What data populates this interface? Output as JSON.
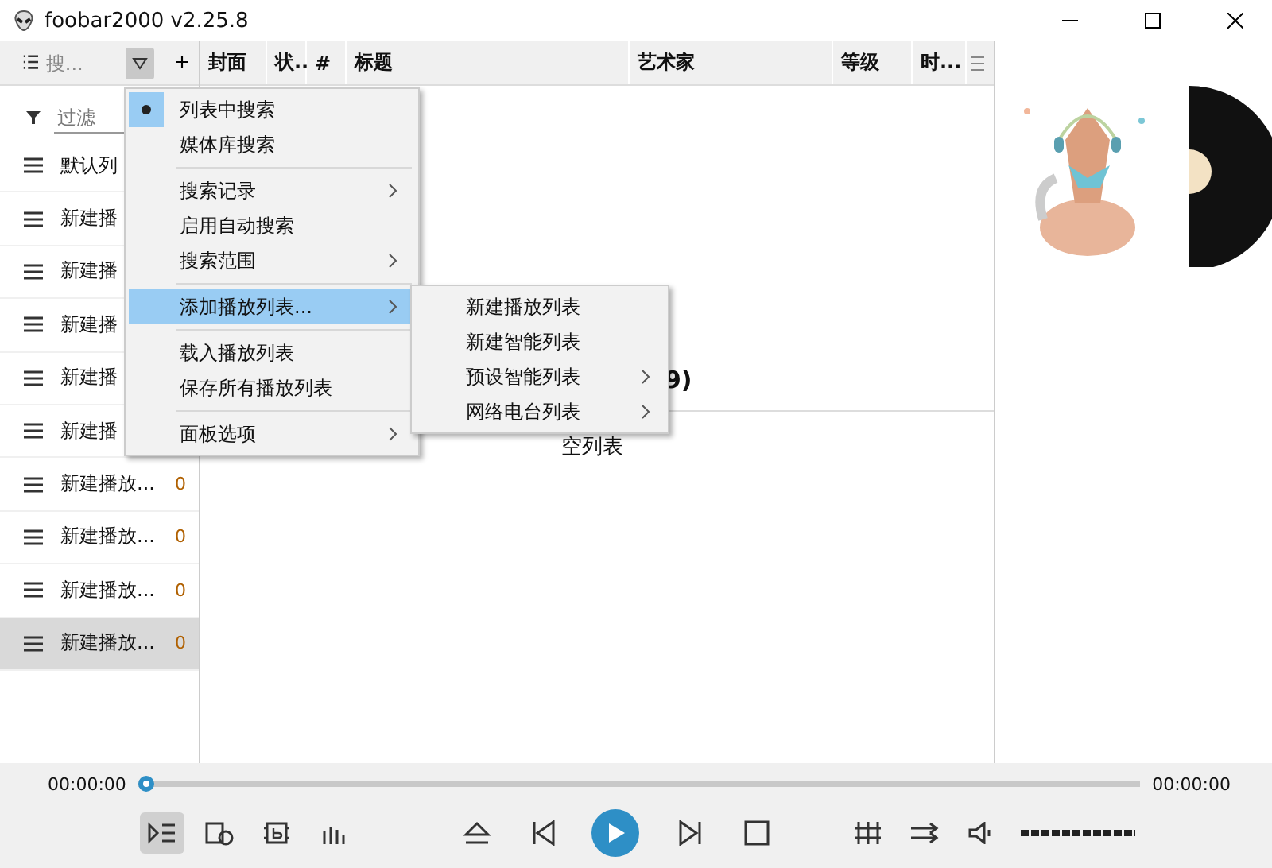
{
  "window": {
    "title": "foobar2000 v2.25.8"
  },
  "toolbar": {
    "search_placeholder": "搜...",
    "add": "+"
  },
  "columns": [
    {
      "label": "封面",
      "kind": "col"
    },
    {
      "label": "状..",
      "kind": "col"
    },
    {
      "label": "#",
      "kind": "col"
    },
    {
      "label": "标题",
      "kind": "col"
    },
    {
      "label": "艺术家",
      "kind": "col"
    },
    {
      "label": "等级",
      "kind": "col"
    },
    {
      "label": "时...",
      "kind": "col"
    }
  ],
  "sidebar": {
    "filter_placeholder": "过滤",
    "items": [
      {
        "name": "默认列",
        "selected": false
      },
      {
        "name": "新建播",
        "selected": false
      },
      {
        "name": "新建播",
        "selected": false
      },
      {
        "name": "新建播",
        "selected": false
      },
      {
        "name": "新建播",
        "selected": false
      },
      {
        "name": "新建播",
        "selected": false
      },
      {
        "name": "新建播放...",
        "count": "0",
        "selected": false
      },
      {
        "name": "新建播放...",
        "count": "0",
        "selected": false
      },
      {
        "name": "新建播放...",
        "count": "0",
        "selected": false
      },
      {
        "name": "新建播放...",
        "count": "0",
        "selected": true
      }
    ]
  },
  "playlist": {
    "heading": "9)",
    "empty": "空列表"
  },
  "menu": [
    {
      "kind": "item",
      "label": "列表中搜索",
      "checked": true,
      "submenu": false,
      "highlighted": false
    },
    {
      "kind": "item",
      "label": "媒体库搜索",
      "checked": false,
      "submenu": false,
      "highlighted": false
    },
    {
      "kind": "separator"
    },
    {
      "kind": "item",
      "label": "搜索记录",
      "checked": false,
      "submenu": true,
      "highlighted": false
    },
    {
      "kind": "item",
      "label": "启用自动搜索",
      "checked": false,
      "submenu": false,
      "highlighted": false
    },
    {
      "kind": "item",
      "label": "搜索范围",
      "checked": false,
      "submenu": true,
      "highlighted": false
    },
    {
      "kind": "separator"
    },
    {
      "kind": "item",
      "label": "添加播放列表...",
      "checked": false,
      "submenu": true,
      "highlighted": true
    },
    {
      "kind": "separator"
    },
    {
      "kind": "item",
      "label": "载入播放列表",
      "checked": false,
      "submenu": false,
      "highlighted": false
    },
    {
      "kind": "item",
      "label": "保存所有播放列表",
      "checked": false,
      "submenu": false,
      "highlighted": false
    },
    {
      "kind": "separator"
    },
    {
      "kind": "item",
      "label": "面板选项",
      "checked": false,
      "submenu": true,
      "highlighted": false
    }
  ],
  "submenu": [
    {
      "label": "新建播放列表",
      "submenu": false
    },
    {
      "label": "新建智能列表",
      "submenu": false
    },
    {
      "label": "预设智能列表",
      "submenu": true
    },
    {
      "label": "网络电台列表",
      "submenu": true
    }
  ],
  "player": {
    "elapsed": "00:00:00",
    "total": "00:00:00",
    "level": 0,
    "volume": {
      "level": 1
    }
  }
}
